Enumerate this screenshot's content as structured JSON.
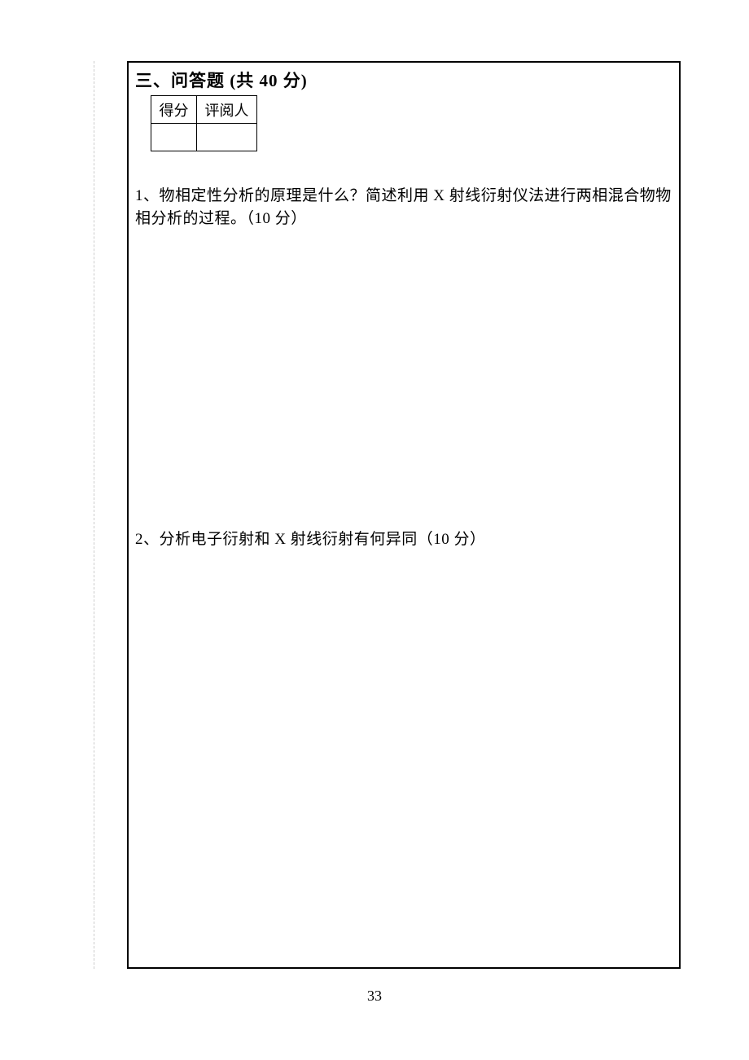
{
  "section": {
    "title": "三、问答题 (共 40 分)"
  },
  "scoreTable": {
    "header1": "得分",
    "header2": "评阅人"
  },
  "questions": {
    "q1": "1、物相定性分析的原理是什么？简述利用 X 射线衍射仪法进行两相混合物物相分析的过程。（10 分）",
    "q2": "2、分析电子衍射和 X 射线衍射有何异同（10 分）"
  },
  "pageNumber": "33"
}
